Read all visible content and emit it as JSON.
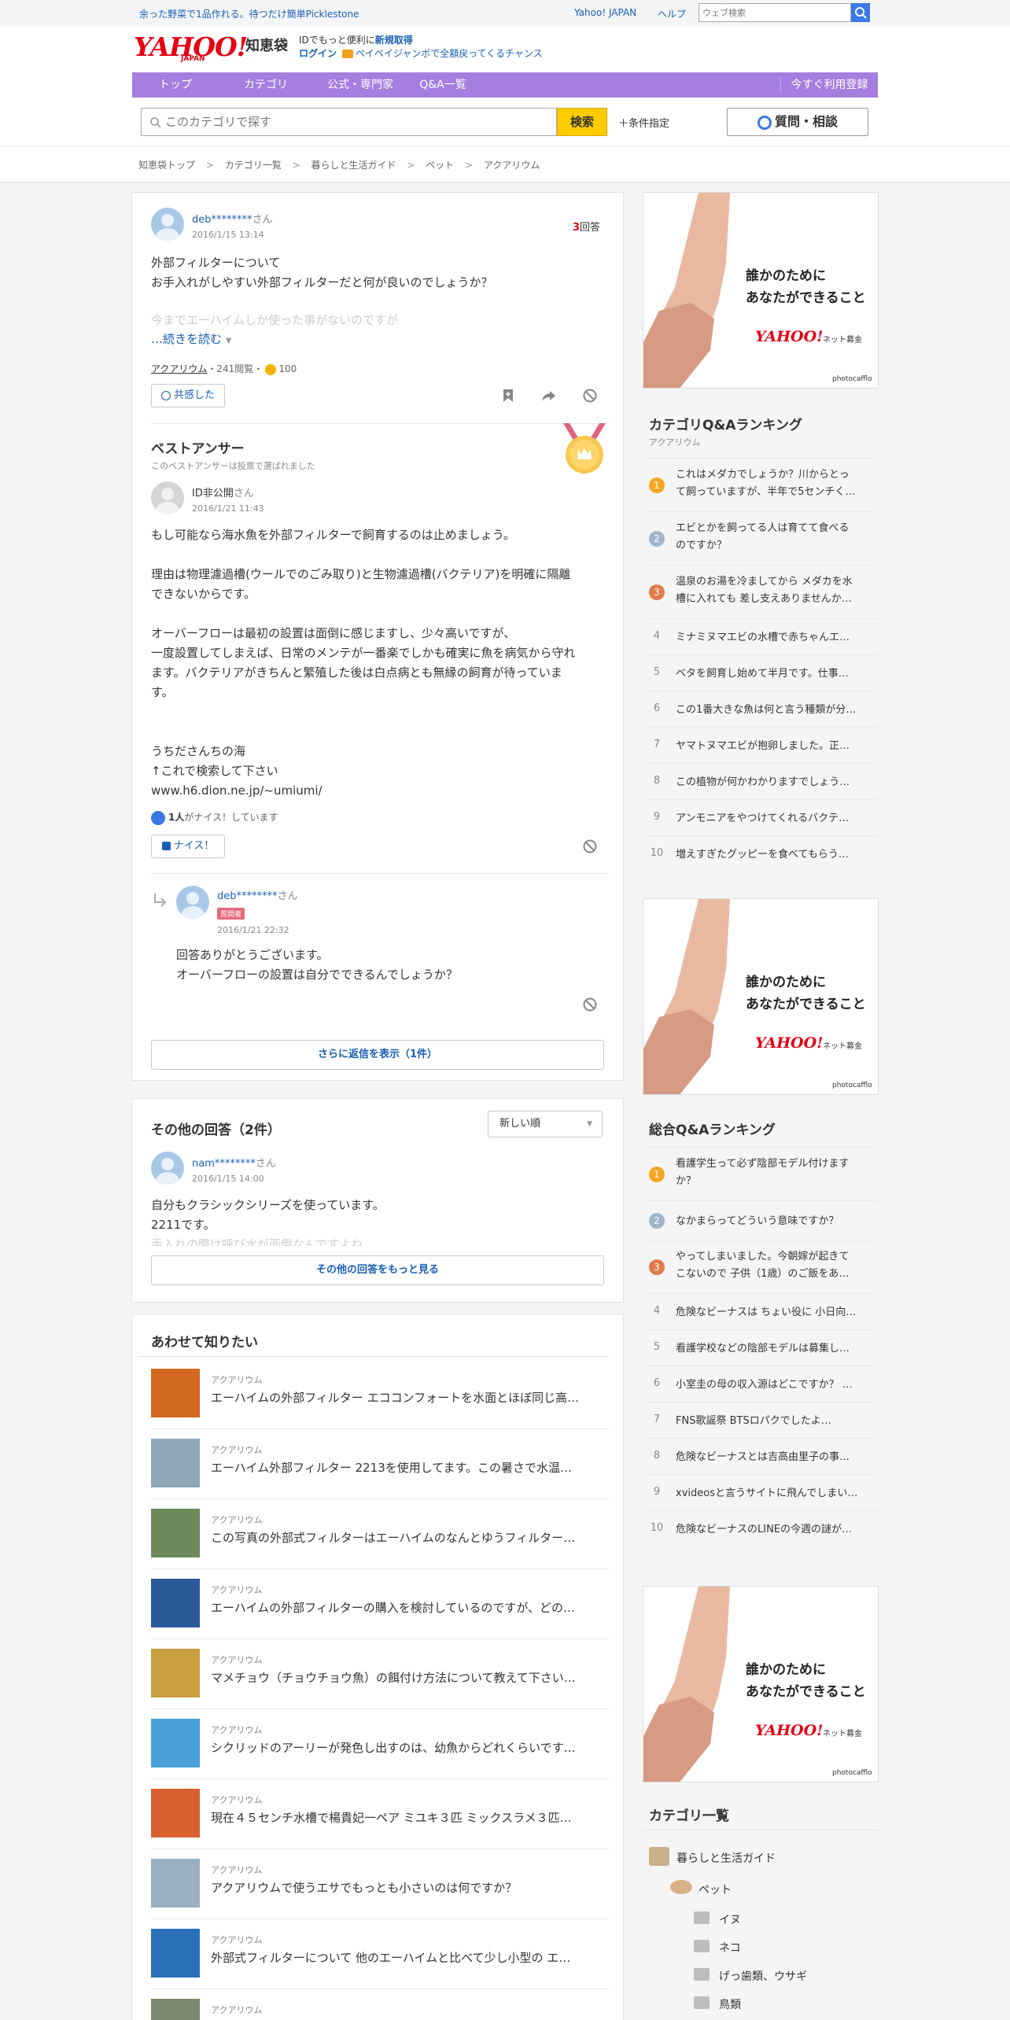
{
  "header": {
    "promo_text": "余った野菜で1品作れる。待つだけ簡単Picklestone",
    "top_links": [
      "Yahoo! JAPAN",
      "ヘルプ"
    ],
    "web_search_placeholder": "ウェブ検索",
    "logo_text": "YAHOO!",
    "logo_sub": "JAPAN",
    "service_name": "知恵袋",
    "id_line_prefix": "IDでもっと便利に",
    "id_line_link": "新規取得",
    "login_label": "ログイン",
    "paypay_text": "ペイペイジャンボで全額戻ってくるチャンス",
    "nav": [
      "トップ",
      "カテゴリ",
      "公式・専門家",
      "Q&A一覧"
    ],
    "nav_right": "今すぐ利用登録",
    "search_placeholder": "このカテゴリで探す",
    "search_button": "検索",
    "conditions": "＋条件指定",
    "ask_button": "質問・相談"
  },
  "breadcrumb": [
    "知恵袋トップ",
    "カテゴリ一覧",
    "暮らしと生活ガイド",
    "ペット",
    "アクアリウム"
  ],
  "question": {
    "user": "deb********",
    "san": "さん",
    "date": "2016/1/15 13:14",
    "answer_count": "3",
    "answer_label": "回答",
    "body_lines": [
      "外部フィルターについて",
      "お手入れがしやすい外部フィルターだと何が良いのでしょうか？"
    ],
    "faded_line": "今までエーハイムしか使った事がないのですが",
    "read_more": "…続きを読む",
    "category": "アクアリウム",
    "views": "・241閲覧・",
    "coin": "100",
    "empathy_button": "共感した"
  },
  "best_answer": {
    "title": "ベストアンサー",
    "note": "このベストアンサーは投票で選ばれました",
    "user": "ID非公開",
    "san": "さん",
    "date": "2016/1/21 11:43",
    "body_lines": [
      "もし可能なら海水魚を外部フィルターで飼育するのは止めましょう。",
      "",
      "理由は物理濾過槽(ウールでのごみ取り)と生物濾過槽(バクテリア)を明確に隔離",
      "できないからです。",
      "",
      "オーバーフローは最初の設置は面倒に感じますし、少々高いですが、",
      "一度設置してしまえば、日常のメンテが一番楽でしかも確実に魚を病気から守れ",
      "ます。バクテリアがきちんと繁殖した後は白点病とも無縁の飼育が待っていま",
      "す。",
      "",
      "",
      "うちださんちの海",
      "↑これで検索して下さい",
      "www.h6.dion.ne.jp/~umiumi/"
    ],
    "nice_count": "1人",
    "nice_suffix": "がナイス！しています",
    "nice_button": "ナイス！"
  },
  "reply": {
    "user": "deb********",
    "san": "さん",
    "badge": "質問者",
    "date": "2016/1/21 22:32",
    "body_lines": [
      "回答ありがとうございます。",
      "オーバーフローの設置は自分でできるんでしょうか？"
    ],
    "more_replies": "さらに返信を表示（1件）"
  },
  "other_answers": {
    "title": "その他の回答（2件）",
    "sort": "新しい順",
    "user": "nam********",
    "san": "さん",
    "date": "2016/1/15 14:00",
    "body_lines": [
      "自分もクラシックシリーズを使っています。",
      "2211です。"
    ],
    "faded_line": "手入れの際は呼び水が面倒なんですよね。",
    "more_button": "その他の回答をもっと見る"
  },
  "related": {
    "title": "あわせて知りたい",
    "items": [
      {
        "category": "アクアリウム",
        "title": "エーハイムの外部フィルター エココンフォートを水面とほぼ同じ高…",
        "thumb": "#d2691e"
      },
      {
        "category": "アクアリウム",
        "title": "エーハイム外部フィルター 2213を使用してます。この暑さで水温…",
        "thumb": "#8fa8b8"
      },
      {
        "category": "アクアリウム",
        "title": "この写真の外部式フィルターはエーハイムのなんとゆうフィルター…",
        "thumb": "#6c8a5a"
      },
      {
        "category": "アクアリウム",
        "title": "エーハイムの外部フィルターの購入を検討しているのですが、どの…",
        "thumb": "#2a5a9a"
      },
      {
        "category": "アクアリウム",
        "title": "マメチョウ（チョウチョウ魚）の餌付け方法について教えて下さい…",
        "thumb": "#c8a040"
      },
      {
        "category": "アクアリウム",
        "title": "シクリッドのアーリーが発色し出すのは、幼魚からどれくらいです…",
        "thumb": "#4aa0d8"
      },
      {
        "category": "アクアリウム",
        "title": "現在４５センチ水槽で楊貴妃一ペア ミユキ３匹 ミックスラメ３匹…",
        "thumb": "#d86030"
      },
      {
        "category": "アクアリウム",
        "title": "アクアリウムで使うエサでもっとも小さいのは何ですか？",
        "thumb": "#9ab0c0"
      },
      {
        "category": "アクアリウム",
        "title": "外部式フィルターについて 他のエーハイムと比べて少し小型の エ…",
        "thumb": "#2a70b8"
      },
      {
        "category": "アクアリウム",
        "title": "",
        "thumb": "#7a8a70"
      }
    ]
  },
  "ad": {
    "line1": "誰かのために",
    "line2": "あなたができること",
    "brand": "YAHOO!",
    "brand_sub": "ネット募金",
    "credit": "photocafflo"
  },
  "category_ranking": {
    "title": "カテゴリQ&Aランキング",
    "subtitle": "アクアリウム",
    "items": [
      {
        "rank": "1",
        "text": "これはメダカでしょうか？川からとっ\nて飼っていますが、半年で5センチく…"
      },
      {
        "rank": "2",
        "text": "エビとかを飼ってる人は育てて食べる\nのですか？"
      },
      {
        "rank": "3",
        "text": "温泉のお湯を冷ましてから メダカを水\n槽に入れても 差し支えありませんか…"
      },
      {
        "rank": "4",
        "text": "ミナミヌマエビの水槽で赤ちゃんエ…"
      },
      {
        "rank": "5",
        "text": "ベタを飼育し始めて半月です。仕事…"
      },
      {
        "rank": "6",
        "text": "この1番大きな魚は何と言う種類が分…"
      },
      {
        "rank": "7",
        "text": "ヤマトヌマエビが抱卵しました。正…"
      },
      {
        "rank": "8",
        "text": "この植物が何かわかりますでしょう…"
      },
      {
        "rank": "9",
        "text": "アンモニアをやつけてくれるバクテ…"
      },
      {
        "rank": "10",
        "text": "増えすぎたグッピーを食べてもらう…"
      }
    ]
  },
  "overall_ranking": {
    "title": "総合Q&Aランキング",
    "items": [
      {
        "rank": "1",
        "text": "看護学生って必ず陰部モデル付けます\nか？"
      },
      {
        "rank": "2",
        "text": "なかまらってどういう意味ですか？"
      },
      {
        "rank": "3",
        "text": "やってしまいました。今朝嫁が起きて\nこないので 子供（1歳）のご飯をあ…"
      },
      {
        "rank": "4",
        "text": "危険なビーナスは ちょい役に 小日向…"
      },
      {
        "rank": "5",
        "text": "看護学校などの陰部モデルは募集し…"
      },
      {
        "rank": "6",
        "text": "小室圭の母の収入源はどこですか？ …"
      },
      {
        "rank": "7",
        "text": "FNS歌謡祭 BTSロパクでしたよ…"
      },
      {
        "rank": "8",
        "text": "危険なビーナスとは吉高由里子の事…"
      },
      {
        "rank": "9",
        "text": "xvideosと言うサイトに飛んでしまい…"
      },
      {
        "rank": "10",
        "text": "危険なビーナスのLINEの今週の謎が…"
      }
    ]
  },
  "category_list": {
    "title": "カテゴリ一覧",
    "root": "暮らしと生活ガイド",
    "child": "ペット",
    "leaves": [
      "イヌ",
      "ネコ",
      "げっ歯類、ウサギ",
      "鳥類"
    ]
  },
  "colors": {
    "nav_purple": "#a57ee0",
    "yahoo_red": "#e60012",
    "search_yellow": "#ffcc00",
    "link_blue": "#1a5fb4",
    "rank_gold": "#f5a623",
    "rank_silver": "#9fb6cc",
    "rank_bronze": "#e07b4c"
  }
}
